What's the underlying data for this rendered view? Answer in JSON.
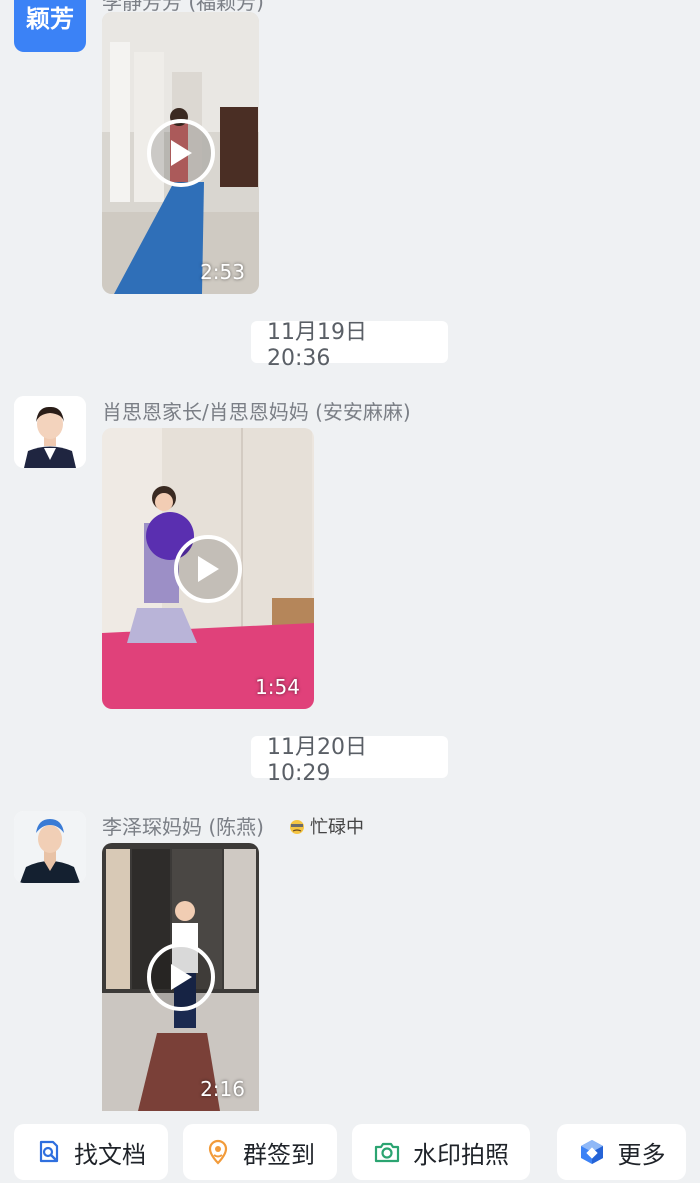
{
  "messages": [
    {
      "avatar_text": "颖芳",
      "video_duration": "2:53"
    },
    {
      "timestamp": "11月19日 20:36",
      "sender": "肖思恩家长/肖思恩妈妈 (安安麻麻)",
      "video_duration": "1:54"
    },
    {
      "timestamp": "11月20日 10:29",
      "sender": "李泽琛妈妈 (陈燕)",
      "status": "忙碌中",
      "video_duration": "2:16"
    }
  ],
  "toolbar": {
    "find_docs": "找文档",
    "group_checkin": "群签到",
    "watermark_photo": "水印拍照",
    "more": "更多"
  },
  "colors": {
    "background": "#eff1f3",
    "accent": "#3b82f6",
    "find_docs_icon": "#2f6fde",
    "checkin_icon": "#f29b3a",
    "camera_icon": "#2ba471"
  }
}
